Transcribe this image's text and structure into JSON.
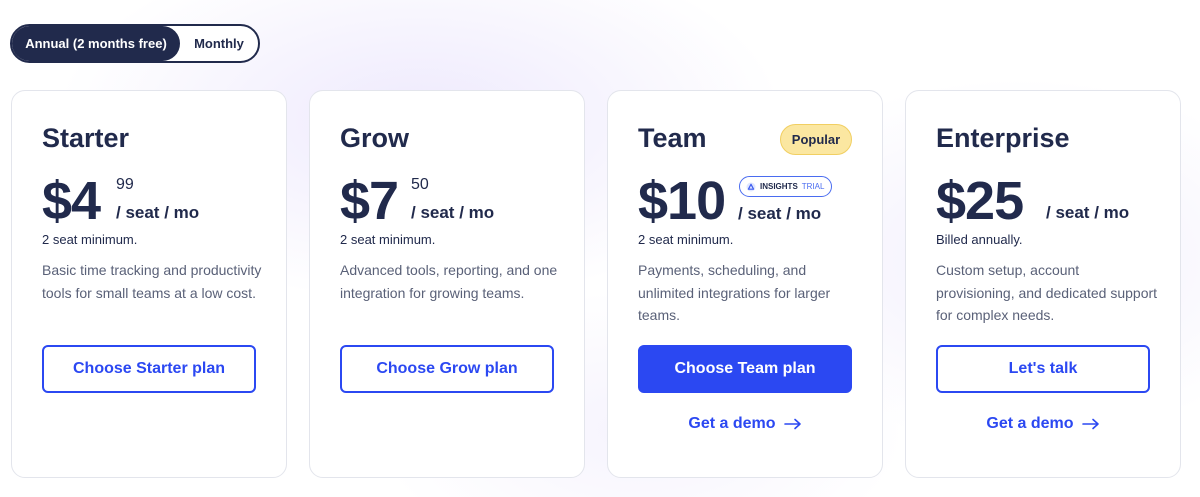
{
  "billing_toggle": {
    "annual_label": "Annual (2 months free)",
    "monthly_label": "Monthly",
    "selected": "annual"
  },
  "colors": {
    "navy": "#212a4c",
    "accent_blue": "#2b48f2",
    "popular_badge_bg": "#fbe7a1",
    "text_muted": "#5a6178"
  },
  "plans": [
    {
      "name": "Starter",
      "currency": "$",
      "price_whole": "4",
      "price_cents": "99",
      "unit": "/ seat / mo",
      "note": "2 seat minimum.",
      "description": "Basic time tracking and productivity tools for small teams at a low cost.",
      "cta_label": "Choose Starter plan"
    },
    {
      "name": "Grow",
      "currency": "$",
      "price_whole": "7",
      "price_cents": "50",
      "unit": "/ seat / mo",
      "note": "2 seat minimum.",
      "description": "Advanced tools, reporting, and one integration for growing teams.",
      "cta_label": "Choose Grow plan"
    },
    {
      "name": "Team",
      "badge": "Popular",
      "insights_badge": {
        "label": "INSIGHTS",
        "trial": "TRIAL",
        "icon": "insights-logo-icon"
      },
      "currency": "$",
      "price_whole": "10",
      "unit": "/ seat / mo",
      "note": "2 seat minimum.",
      "description": "Payments, scheduling, and unlimited integrations for larger teams.",
      "cta_label": "Choose Team plan",
      "demo_label": "Get a demo"
    },
    {
      "name": "Enterprise",
      "currency": "$",
      "price_whole": "25",
      "unit": "/ seat / mo",
      "note": "Billed annually.",
      "description": "Custom setup, account provisioning, and dedicated support for complex needs.",
      "cta_label": "Let's talk",
      "demo_label": "Get a demo"
    }
  ]
}
